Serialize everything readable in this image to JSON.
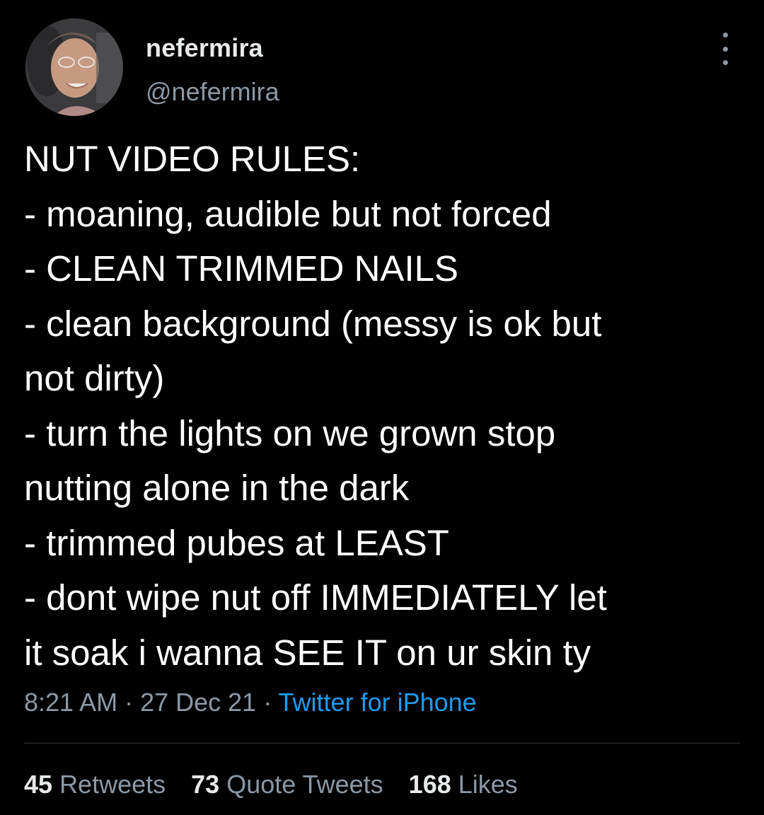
{
  "author": {
    "display_name": "nefermira",
    "handle": "@nefermira",
    "avatar_icon": "avatar-photo"
  },
  "tweet": {
    "lines": [
      "NUT VIDEO RULES:",
      "- moaning, audible but not forced",
      "- CLEAN TRIMMED NAILS",
      "- clean background (messy is ok but",
      "not dirty)",
      "- turn the lights on we grown stop",
      "nutting alone in the dark",
      "- trimmed pubes at LEAST",
      "- dont wipe nut off IMMEDIATELY let",
      "it soak i wanna SEE IT on ur skin ty"
    ]
  },
  "meta": {
    "time": "8:21 AM",
    "sep1": " · ",
    "date": "27 Dec 21",
    "sep2": " · ",
    "source": "Twitter for iPhone"
  },
  "stats": {
    "retweets_count": "45",
    "retweets_label": "Retweets",
    "quotes_count": "73",
    "quotes_label": "Quote Tweets",
    "likes_count": "168",
    "likes_label": "Likes"
  },
  "colors": {
    "background": "#000000",
    "primary_text": "#e7e9ea",
    "secondary_text": "#8b98a5",
    "link": "#1d9bf0",
    "divider": "#2f3336"
  },
  "icons": {
    "more": "more-horizontal-icon"
  }
}
